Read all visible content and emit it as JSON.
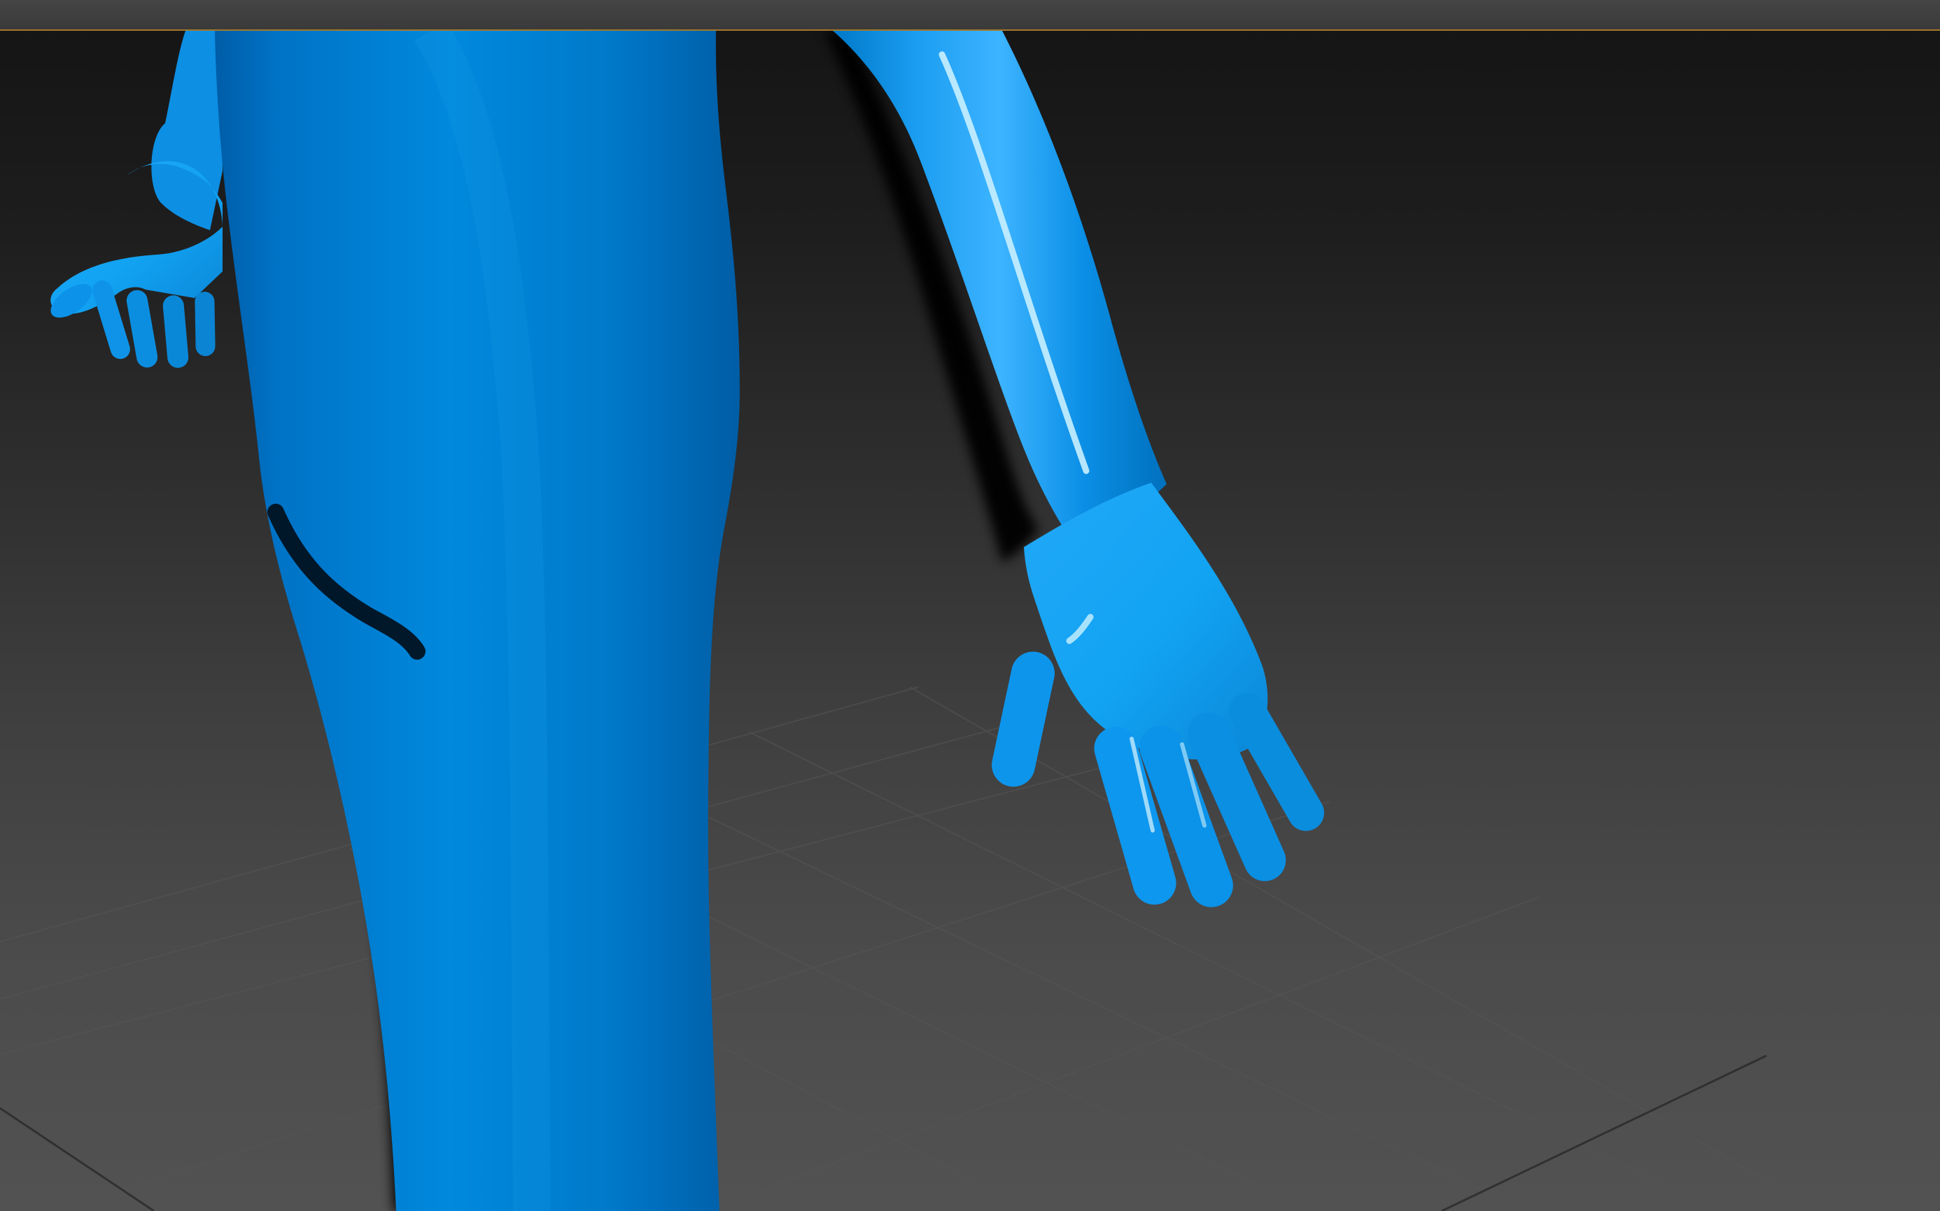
{
  "scene": {
    "viewport_name": "3d-perspective-viewport",
    "model_color": "#0f8fe0",
    "highlight_color": "#39b8ff",
    "shadow_color": "#006bb8",
    "grid_color": "#555555",
    "icons": {
      "model": "human-figure-icon"
    }
  }
}
